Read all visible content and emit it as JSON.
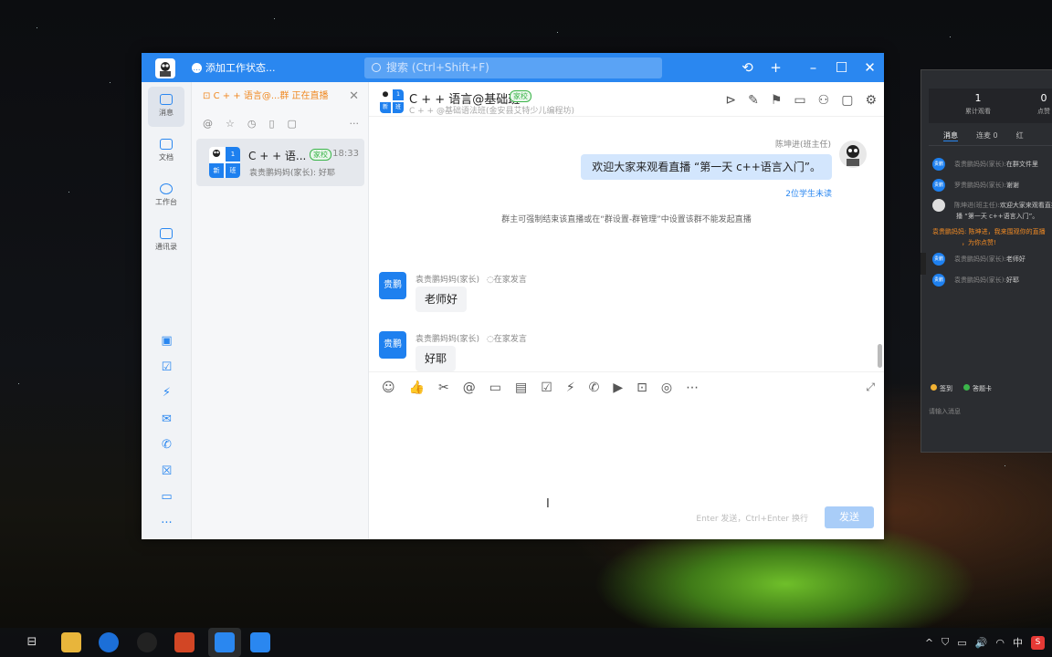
{
  "window": {
    "status_label": "添加工作状态...",
    "search_placeholder": "搜索 (Ctrl+Shift+F)",
    "title_icons": [
      "history-icon",
      "plus-icon",
      "minimize-icon",
      "maximize-icon",
      "close-icon"
    ]
  },
  "nav": {
    "items": [
      {
        "label": "消息",
        "icon": "message-icon"
      },
      {
        "label": "文档",
        "icon": "document-icon"
      },
      {
        "label": "工作台",
        "icon": "workbench-icon"
      },
      {
        "label": "通讯录",
        "icon": "contacts-icon"
      }
    ],
    "bottom_icons": [
      "calendar-icon",
      "todo-icon",
      "flash-icon",
      "mail-icon",
      "phone-icon",
      "checklist-icon",
      "folder-icon",
      "more-icon"
    ],
    "more_glyph": "···"
  },
  "convlist": {
    "live_banner": "C + + 语言@...群 正在直播",
    "filter_more": "···",
    "conversation": {
      "name": "C + + 语...",
      "tag": "家校",
      "time": "18:33",
      "preview": "袁贵鹏妈妈(家长): 好耶",
      "avatar_badges": [
        "1",
        "班",
        "级",
        "新"
      ]
    }
  },
  "chat": {
    "title": "C + + 语言@基础班",
    "tag": "家校",
    "subtitle": "C + + @基础语法班(金安县艾特少儿编程坊)",
    "self_name": "陈坤进(班主任)",
    "self_message": "欢迎大家来观看直播 “第一天 c++语言入门”。",
    "unread": "2位学生未读",
    "system_message": "群主可强制结束该直播或在“群设置-群管理”中设置该群不能发起直播",
    "messages": [
      {
        "avatar": "贵鹏",
        "sender": "袁贵鹏妈妈(家长)",
        "location": "在家发言",
        "text": "老师好"
      },
      {
        "avatar": "贵鹏",
        "sender": "袁贵鹏妈妈(家长)",
        "location": "在家发言",
        "text": "好耶"
      }
    ],
    "input_hint": "Enter 发送，Ctrl+Enter 换行",
    "send_label": "发送"
  },
  "live_panel": {
    "stats": [
      {
        "value": "1",
        "label": "累计观看"
      },
      {
        "value": "0",
        "label": "点赞"
      }
    ],
    "tabs": [
      "消息",
      "连麦 0",
      "红"
    ],
    "messages": [
      {
        "badge": "贵鹏",
        "name": "袁贵鹏妈妈(家长):",
        "text": "在群文件里"
      },
      {
        "badge": "贵鹏",
        "name": "罗贵鹏妈妈(家长):",
        "text": "谢谢"
      },
      {
        "badge": "",
        "name": "陈坤进(班主任):",
        "text": "欢迎大家来观看直播"
      },
      {
        "badge": "",
        "name": "",
        "text": "播 “第一天 c++语言入门”。"
      }
    ],
    "orange_1": "袁贵鹏妈妈: 陈坤进，我来围观你的直播",
    "orange_2": "，为你点赞!",
    "messages2": [
      {
        "badge": "贵鹏",
        "name": "袁贵鹏妈妈(家长):",
        "text": "老师好"
      },
      {
        "badge": "贵鹏",
        "name": "袁贵鹏妈妈(家长):",
        "text": "好耶"
      }
    ],
    "footer_1": "签到",
    "footer_2": "答题卡",
    "input_placeholder": "请输入消息"
  },
  "taskbar": {
    "tray_ime": "中",
    "tray_s": "S"
  },
  "colors": {
    "accent": "#2a87f0",
    "tag_green": "#3bb54a",
    "live_orange": "#f08a24"
  }
}
